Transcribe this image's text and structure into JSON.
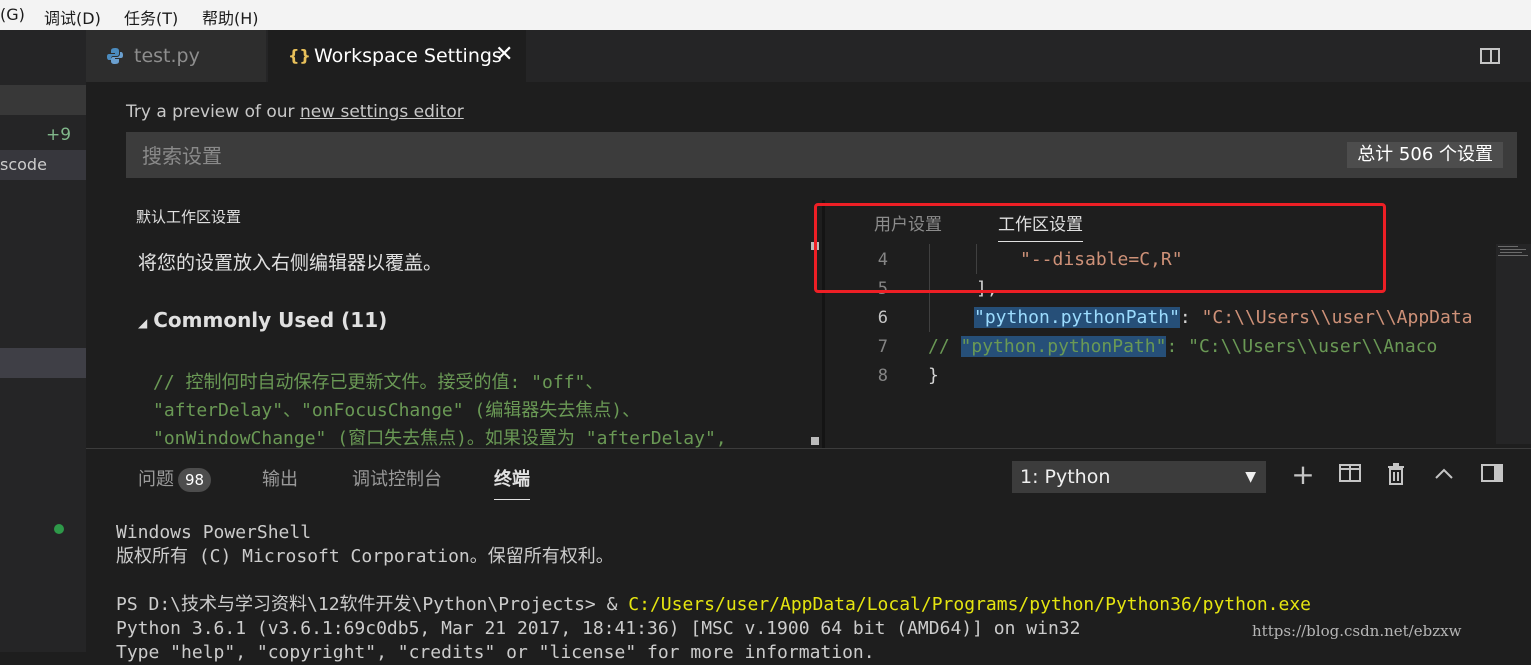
{
  "menubar": {
    "items": [
      "(G)",
      "调试(D)",
      "任务(T)",
      "帮助(H)"
    ]
  },
  "sidebar": {
    "badge": "+9",
    "item_label": "scode"
  },
  "tabs": {
    "test": "test.py",
    "workspace": "Workspace Settings"
  },
  "settings": {
    "preview_prefix": "Try a preview of our ",
    "preview_link": "new settings editor",
    "search_placeholder": "搜索设置",
    "count": "总计 506 个设置",
    "default_title": "默认工作区设置",
    "override_hint": "将您的设置放入右侧编辑器以覆盖。",
    "section_title": "Commonly Used (11)",
    "comment_lines": [
      "// 控制何时自动保存已更新文件。接受的值: \"off\"、",
      "\"afterDelay\"、\"onFocusChange\" (编辑器失去焦点)、",
      "\"onWindowChange\" (窗口失去焦点)。如果设置为 \"afterDelay\","
    ],
    "tab_user": "用户设置",
    "tab_workspace": "工作区设置"
  },
  "code": {
    "line_numbers": [
      "4",
      "5",
      "6",
      "7",
      "8"
    ],
    "line4": "\"--disable=C,R\"",
    "line5": "],",
    "line6_key": "\"python.pythonPath\"",
    "line6_sep": ": ",
    "line6_val": "\"C:\\\\Users\\\\user\\\\AppData",
    "line7_comment": "//",
    "line7_key": "\"python.pythonPath\"",
    "line7_sep": ": ",
    "line7_val": "\"C:\\\\Users\\\\user\\\\Anaco",
    "line8": "}"
  },
  "panel": {
    "tabs": {
      "problems": "问题",
      "problems_count": "98",
      "output": "输出",
      "debug": "调试控制台",
      "terminal": "终端"
    },
    "terminal_select": "1: Python",
    "terminal": {
      "l1": "Windows PowerShell",
      "l2": "版权所有 (C) Microsoft Corporation。保留所有权利。",
      "l3_prompt": "PS D:\\技术与学习资料\\12软件开发\\Python\\Projects> & ",
      "l3_cmd": "C:/Users/user/AppData/Local/Programs/python/Python36/python.exe",
      "l4": "Python 3.6.1 (v3.6.1:69c0db5, Mar 21 2017, 18:41:36) [MSC v.1900 64 bit (AMD64)] on win32",
      "l5": "Type \"help\", \"copyright\", \"credits\" or \"license\" for more information."
    }
  },
  "watermark": "https://blog.csdn.net/ebzxw",
  "colors": {
    "accent_red_box": "#ee1f25",
    "string": "#ce9178",
    "key": "#9cdcfe",
    "comment": "#6a9955",
    "terminal_path": "#e5e510"
  }
}
